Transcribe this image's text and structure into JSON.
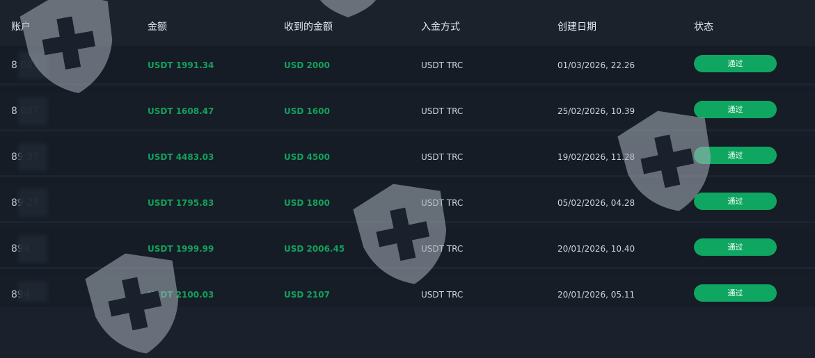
{
  "columns": {
    "account": "账户",
    "amount": "金额",
    "received": "收到的金额",
    "method": "入金方式",
    "created": "创建日期",
    "status": "状态"
  },
  "rows": [
    {
      "account": "8   087",
      "amount": "USDT 1991.34",
      "received": "USD 2000",
      "method": "USDT TRC",
      "date": "01/03/2026, 22.26",
      "status": "通过"
    },
    {
      "account": "8   087",
      "amount": "USDT 1608.47",
      "received": "USD 1600",
      "method": "USDT TRC",
      "date": "25/02/2026, 10.39",
      "status": "通过"
    },
    {
      "account": "89  37",
      "amount": "USDT 4483.03",
      "received": "USD 4500",
      "method": "USDT TRC",
      "date": "19/02/2026, 11.28",
      "status": "通过"
    },
    {
      "account": "89  27",
      "amount": "USDT 1795.83",
      "received": "USD 1800",
      "method": "USDT TRC",
      "date": "05/02/2026, 04.28",
      "status": "通过"
    },
    {
      "account": "894",
      "amount": "USDT 1999.99",
      "received": "USD 2006.45",
      "method": "USDT TRC",
      "date": "20/01/2026, 10.40",
      "status": "通过"
    },
    {
      "account": "894",
      "amount": "USDT 2100.03",
      "received": "USD 2107",
      "method": "USDT TRC",
      "date": "20/01/2026, 05.11",
      "status": "通过"
    }
  ],
  "colors": {
    "background": "#1a212c",
    "amount_green": "#13a15c",
    "status_green": "#0fa661"
  },
  "icons": [
    "shield-cross-watermark-icon"
  ]
}
